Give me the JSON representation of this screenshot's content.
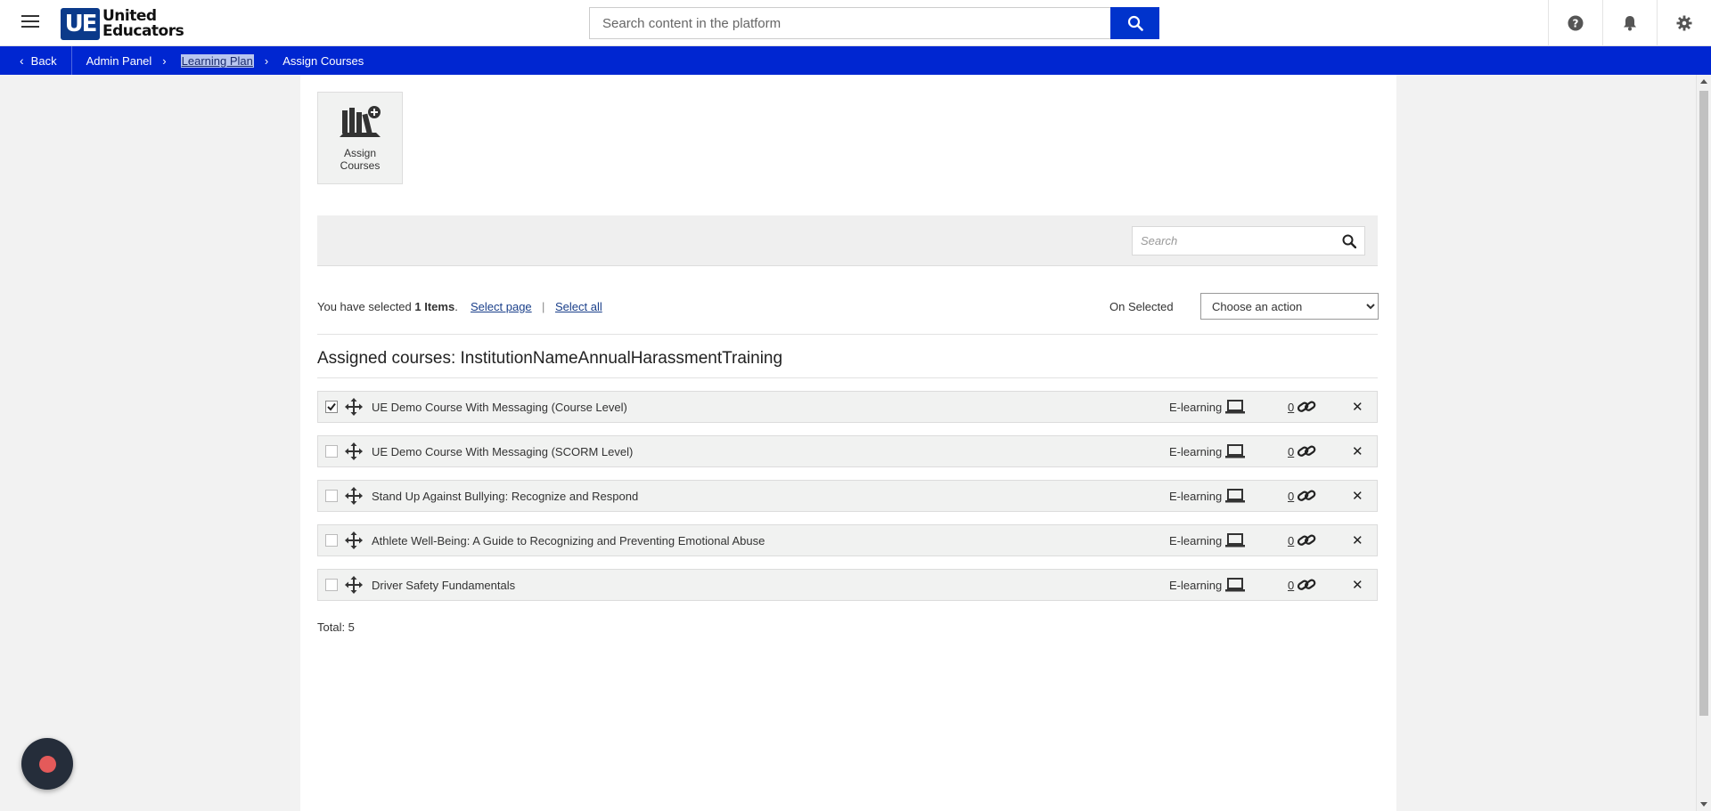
{
  "header": {
    "logo_mark": "UE",
    "logo_line1": "United",
    "logo_line2": "Educators",
    "search_placeholder": "Search content in the platform"
  },
  "breadcrumb": {
    "back_label": "Back",
    "items": [
      "Admin Panel",
      "Learning Plan",
      "Assign Courses"
    ]
  },
  "toolbar": {
    "assign_line1": "Assign",
    "assign_line2": "Courses"
  },
  "filter": {
    "search_placeholder": "Search"
  },
  "selection": {
    "prefix": "You have selected ",
    "count": "1 Items",
    "suffix": ".",
    "select_page": "Select page",
    "separator": "|",
    "select_all": "Select all",
    "on_selected_label": "On Selected",
    "action_selected": "Choose an action"
  },
  "list": {
    "title": "Assigned courses: InstitutionNameAnnualHarassmentTraining",
    "courses": [
      {
        "name": "UE Demo Course With Messaging (Course Level)",
        "type": "E-learning",
        "count": "0",
        "checked": true
      },
      {
        "name": "UE Demo Course With Messaging (SCORM Level)",
        "type": "E-learning",
        "count": "0",
        "checked": false
      },
      {
        "name": "Stand Up Against Bullying: Recognize and Respond",
        "type": "E-learning",
        "count": "0",
        "checked": false
      },
      {
        "name": "Athlete Well-Being: A Guide to Recognizing and Preventing Emotional Abuse",
        "type": "E-learning",
        "count": "0",
        "checked": false
      },
      {
        "name": "Driver Safety Fundamentals",
        "type": "E-learning",
        "count": "0",
        "checked": false
      }
    ],
    "total": "Total: 5"
  },
  "colors": {
    "brand_blue": "#0026d1",
    "search_button": "#0033cc",
    "record_dot": "#e45a5a"
  },
  "icons": [
    "hamburger-icon",
    "search-icon",
    "help-icon",
    "bell-icon",
    "gear-icon",
    "books-add-icon",
    "move-icon",
    "laptop-icon",
    "link-icon",
    "close-icon",
    "record-icon"
  ]
}
